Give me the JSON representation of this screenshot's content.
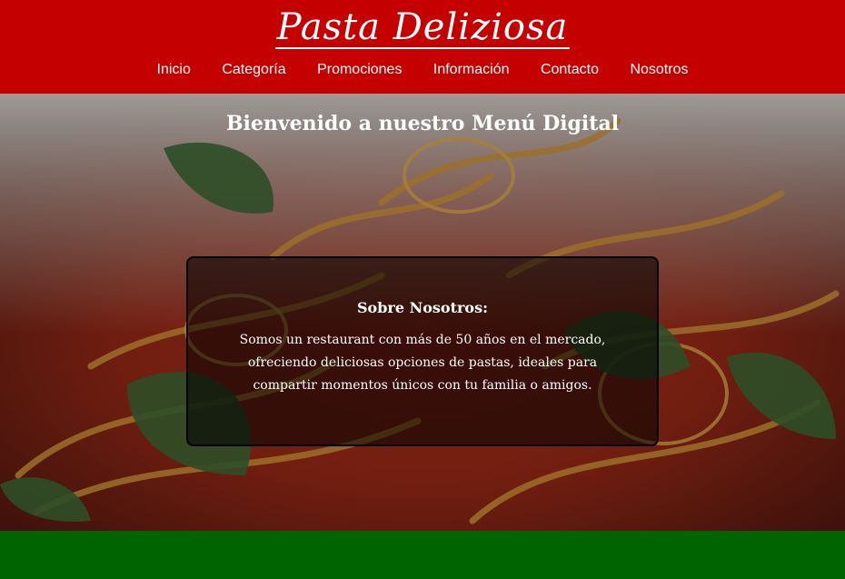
{
  "brand": {
    "name": "Pasta Deliziosa"
  },
  "nav": {
    "items": [
      {
        "label": "Inicio"
      },
      {
        "label": "Categoría"
      },
      {
        "label": "Promociones"
      },
      {
        "label": "Información"
      },
      {
        "label": "Contacto"
      },
      {
        "label": "Nosotros"
      }
    ]
  },
  "hero": {
    "title": "Bienvenido a nuestro Menú Digital",
    "image": "spaghetti-pomodoro-basil-photo"
  },
  "about": {
    "title": "Sobre Nosotros:",
    "text": "Somos un restaurant con más de 50 años en el mercado, ofreciendo deliciosas opciones de pastas, ideales para compartir momentos únicos con tu familia o amigos."
  },
  "colors": {
    "header": "#c50000",
    "footer": "#006400",
    "text": "#ffffff"
  }
}
